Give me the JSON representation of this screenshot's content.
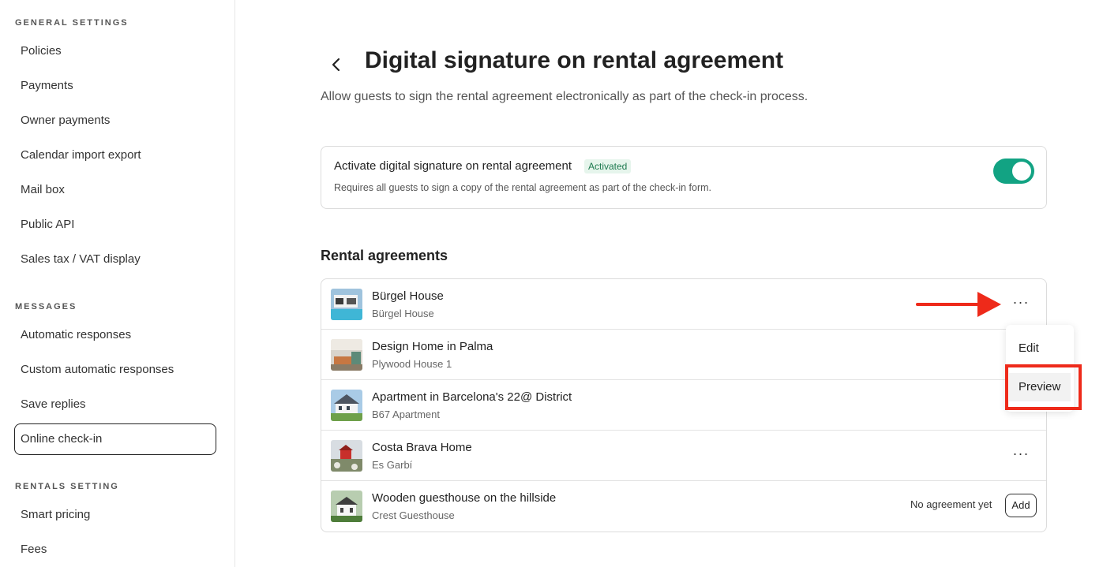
{
  "sidebar": {
    "sections": [
      {
        "title": "GENERAL SETTINGS",
        "items": [
          "Policies",
          "Payments",
          "Owner payments",
          "Calendar import export",
          "Mail box",
          "Public API",
          "Sales tax / VAT display"
        ]
      },
      {
        "title": "MESSAGES",
        "items": [
          "Automatic responses",
          "Custom automatic responses",
          "Save replies",
          "Online check-in"
        ]
      },
      {
        "title": "RENTALS SETTING",
        "items": [
          "Smart pricing",
          "Fees"
        ]
      }
    ],
    "active_item": "Online check-in"
  },
  "page": {
    "title": "Digital signature on rental agreement",
    "subtitle": "Allow guests to sign the rental agreement electronically as part of the check-in process."
  },
  "activation": {
    "title": "Activate digital signature on rental agreement",
    "badge": "Activated",
    "description": "Requires all guests to sign a copy of the rental agreement as part of the check-in form.",
    "enabled": true,
    "toggle_color": "#12a383"
  },
  "agreements": {
    "heading": "Rental agreements",
    "rows": [
      {
        "title": "Bürgel House",
        "subtitle": "Bürgel House",
        "has_menu": true
      },
      {
        "title": "Design Home in Palma",
        "subtitle": "Plywood House 1",
        "has_menu": true
      },
      {
        "title": "Apartment in Barcelona's 22@ District",
        "subtitle": "B67 Apartment",
        "has_menu": true
      },
      {
        "title": "Costa Brava Home",
        "subtitle": "Es Garbí",
        "has_menu": true
      },
      {
        "title": "Wooden guesthouse on the hillside",
        "subtitle": "Crest Guesthouse",
        "status": "No agreement yet",
        "action": "Add"
      }
    ],
    "more_label": "···"
  },
  "menu": {
    "items": [
      "Edit",
      "Preview"
    ],
    "highlighted": "Preview"
  },
  "annotation": {
    "color": "#ee2a1a"
  }
}
